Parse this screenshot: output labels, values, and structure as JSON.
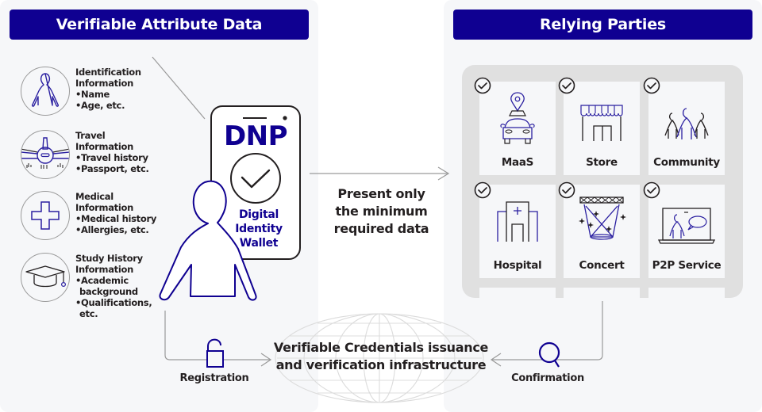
{
  "left_panel": {
    "title": "Verifiable Attribute Data",
    "attributes": [
      {
        "icon": "person-icon",
        "title_lines": [
          "Identification",
          "Information"
        ],
        "bullets": [
          [
            "•Name"
          ],
          [
            "•Age, etc."
          ]
        ]
      },
      {
        "icon": "airplane-icon",
        "title_lines": [
          "Travel",
          "Information"
        ],
        "bullets": [
          [
            "•Travel history"
          ],
          [
            "•Passport, etc."
          ]
        ]
      },
      {
        "icon": "medical-cross-icon",
        "title_lines": [
          "Medical",
          "Information"
        ],
        "bullets": [
          [
            "•Medical history"
          ],
          [
            "•Allergies, etc."
          ]
        ]
      },
      {
        "icon": "graduation-cap-icon",
        "title_lines": [
          "Study History",
          "Information"
        ],
        "bullets": [
          [
            "•Academic",
            "background"
          ],
          [
            "•Qualifications,",
            "etc."
          ]
        ]
      }
    ]
  },
  "wallet": {
    "logo": "DNP",
    "label_lines": [
      "Digital",
      "Identity",
      "Wallet"
    ]
  },
  "center": {
    "present_lines": [
      "Present only",
      "the minimum",
      "required data"
    ],
    "infrastructure_lines": [
      "Verifiable Credentials issuance",
      "and verification infrastructure"
    ],
    "registration_label": "Registration",
    "confirmation_label": "Confirmation"
  },
  "right_panel": {
    "title": "Relying Parties",
    "parties": [
      {
        "label": "MaaS",
        "icon": "car-location-icon",
        "checked": true
      },
      {
        "label": "Store",
        "icon": "store-icon",
        "checked": true
      },
      {
        "label": "Community",
        "icon": "community-icon",
        "checked": true
      },
      {
        "label": "Hospital",
        "icon": "hospital-icon",
        "checked": true
      },
      {
        "label": "Concert",
        "icon": "concert-stage-icon",
        "checked": true
      },
      {
        "label": "P2P Service",
        "icon": "p2p-presentation-icon",
        "checked": true
      }
    ]
  },
  "colors": {
    "brand_navy": "#0f0091",
    "icon_blue": "#2a1fa0",
    "text_dark": "#231f20",
    "panel_bg": "#f6f7f9",
    "frame_gray": "#e0e0e0",
    "line_gray": "#9a9a9a"
  }
}
